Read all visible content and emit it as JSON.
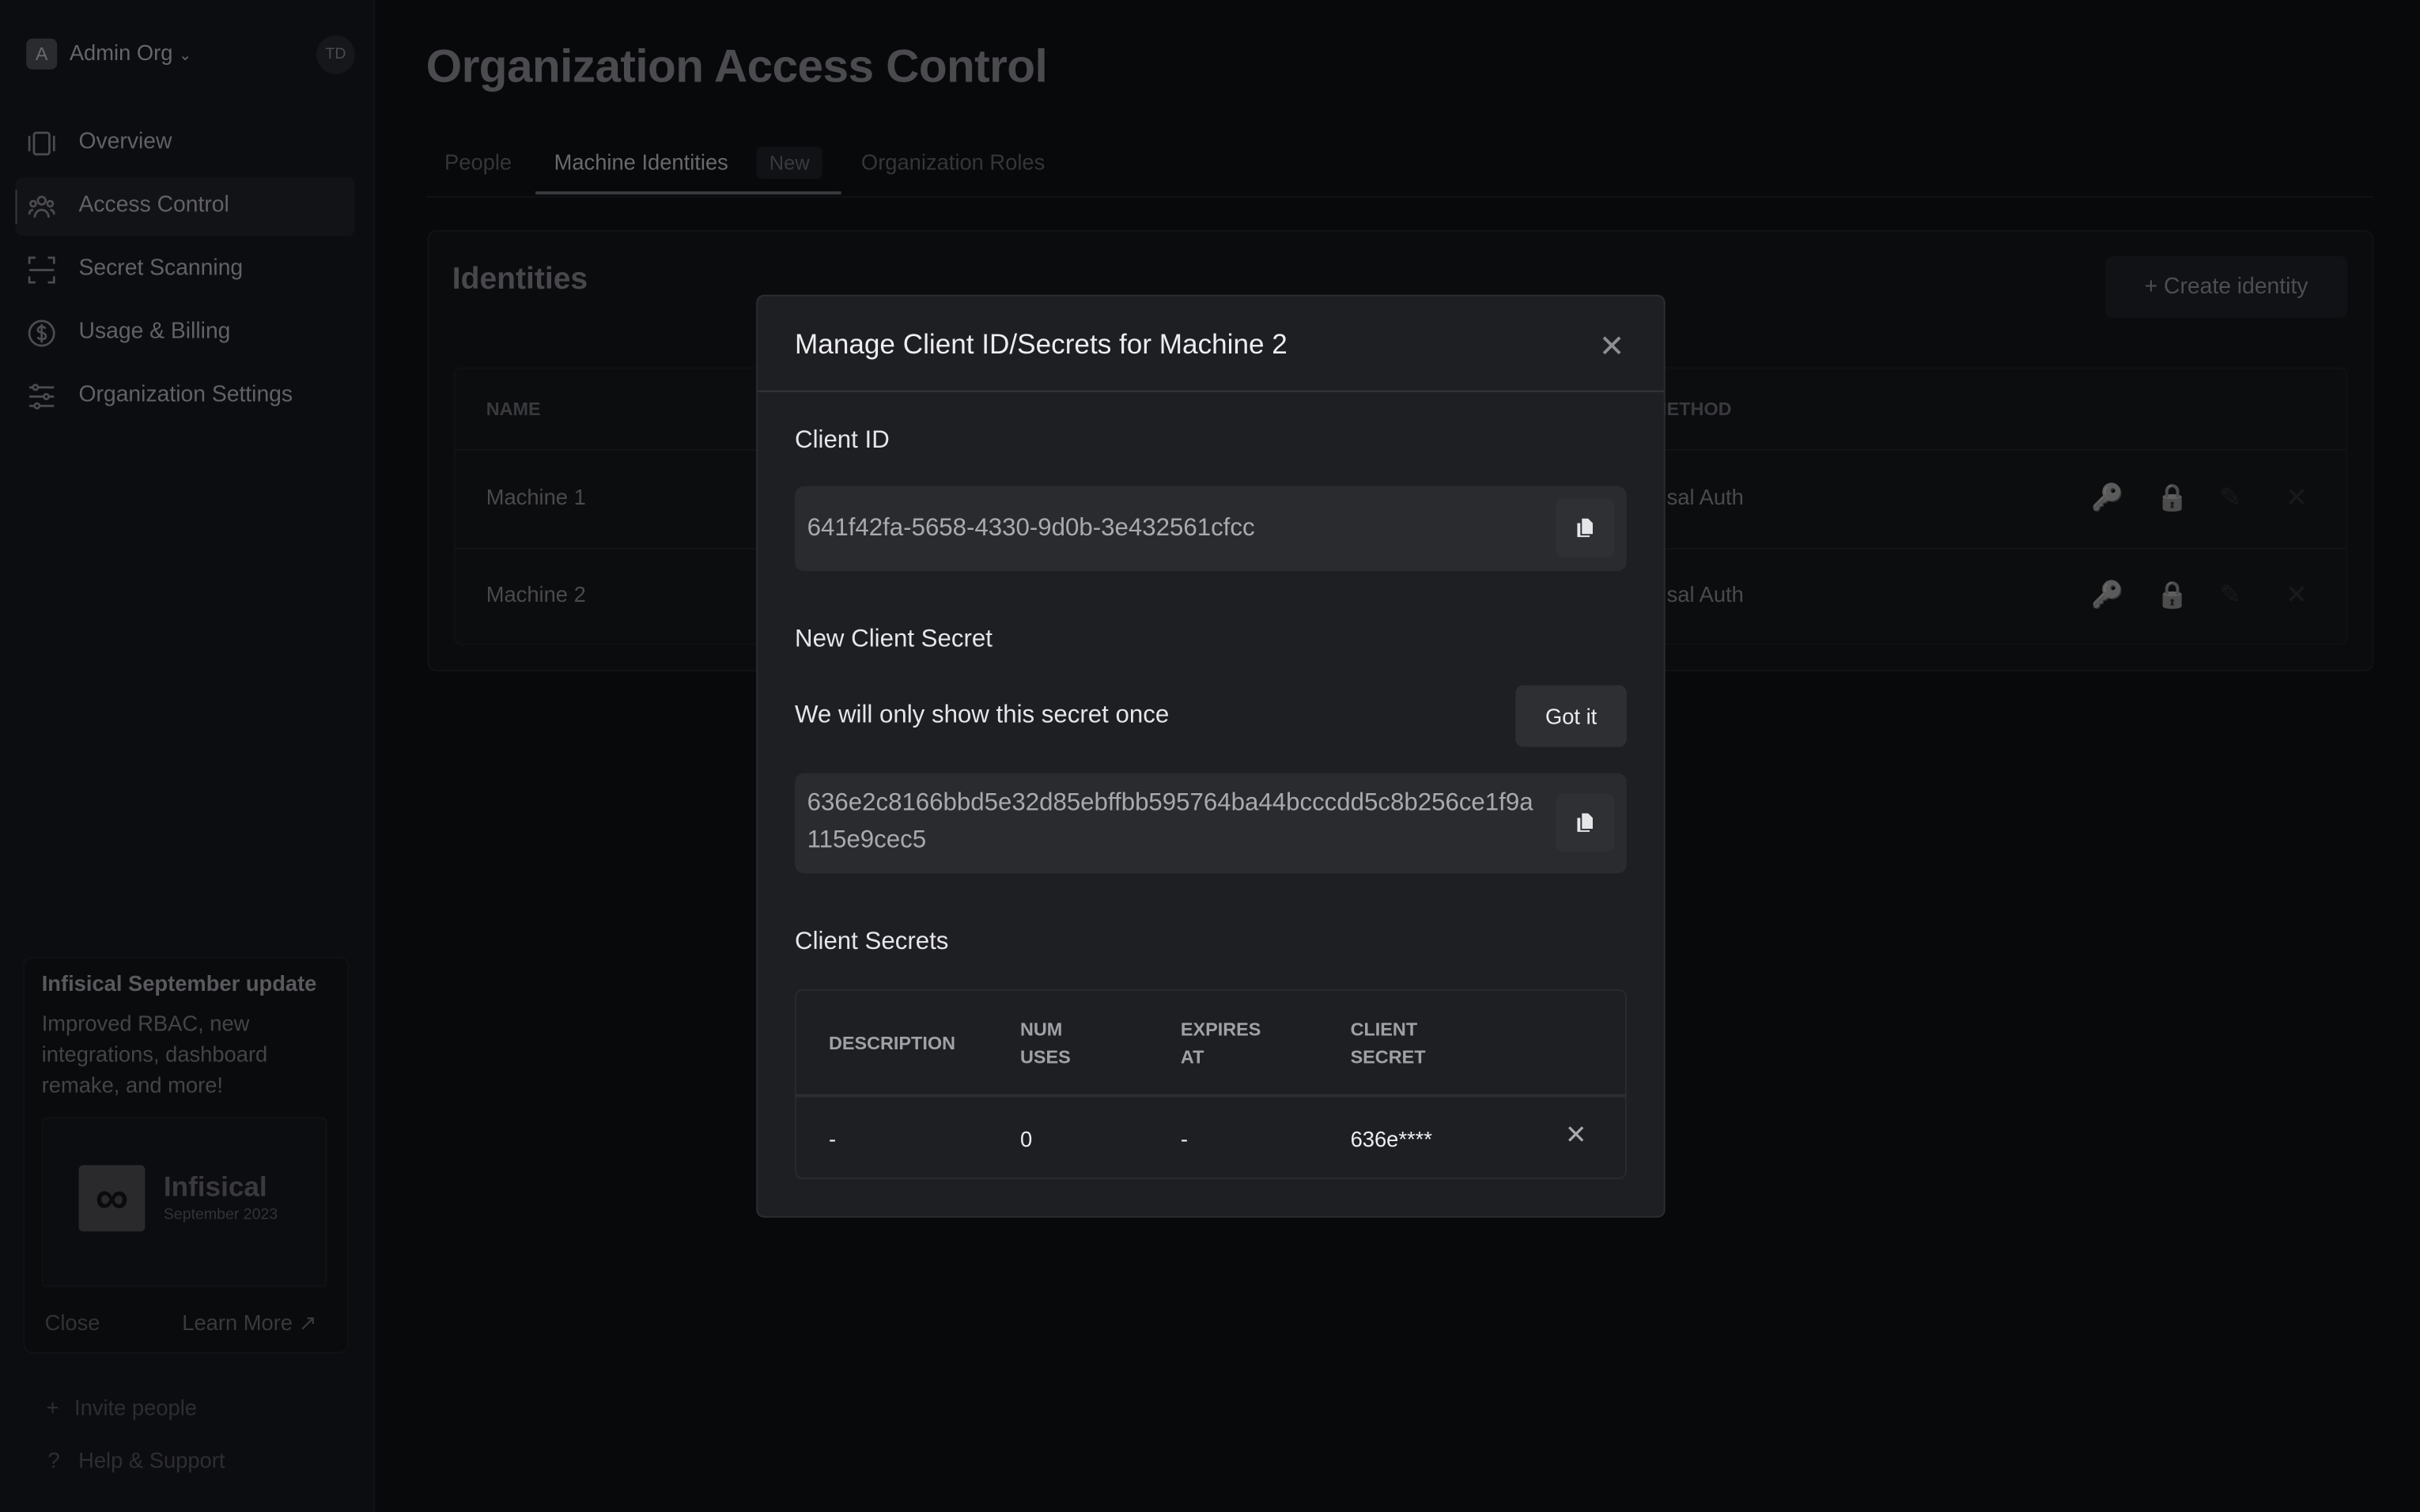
{
  "sidebar": {
    "org_initial": "A",
    "org_name": "Admin Org",
    "user_initials": "TD",
    "items": [
      {
        "label": "Overview",
        "icon": "overview-icon"
      },
      {
        "label": "Access Control",
        "icon": "users-icon",
        "active": true
      },
      {
        "label": "Secret Scanning",
        "icon": "scan-icon"
      },
      {
        "label": "Usage & Billing",
        "icon": "dollar-icon"
      },
      {
        "label": "Organization Settings",
        "icon": "sliders-icon"
      }
    ],
    "update_card": {
      "title": "Infisical September update",
      "body": "Improved RBAC, new integrations, dashboard remake, and more!",
      "image_brand": "Infisical",
      "image_caption": "September 2023",
      "close": "Close",
      "learn_more": "Learn More"
    },
    "invite": "Invite people",
    "help": "Help & Support"
  },
  "main": {
    "title": "Organization Access Control",
    "tabs": [
      {
        "label": "People"
      },
      {
        "label": "Machine Identities",
        "badge": "New",
        "active": true
      },
      {
        "label": "Organization Roles"
      }
    ],
    "panel_title": "Identities",
    "create_button": "Create identity",
    "table": {
      "headers": [
        "NAME",
        "METHOD"
      ],
      "rows": [
        {
          "name": "Machine 1",
          "method": "sal Auth"
        },
        {
          "name": "Machine 2",
          "method": "sal Auth"
        }
      ]
    }
  },
  "modal": {
    "title": "Manage Client ID/Secrets for Machine 2",
    "client_id_label": "Client ID",
    "client_id": "641f42fa-5658-4330-9d0b-3e432561cfcc",
    "new_secret_label": "New Client Secret",
    "notice": "We will only show this secret once",
    "got_it": "Got it",
    "new_secret": "636e2c8166bbd5e32d85ebffbb595764ba44bcccdd5c8b256ce1f9a115e9cec5",
    "secrets_label": "Client Secrets",
    "secrets_table": {
      "headers": [
        "DESCRIPTION",
        "NUM USES",
        "EXPIRES AT",
        "CLIENT SECRET"
      ],
      "rows": [
        {
          "description": "-",
          "num_uses": "0",
          "expires_at": "-",
          "client_secret": "636e****"
        }
      ]
    }
  }
}
